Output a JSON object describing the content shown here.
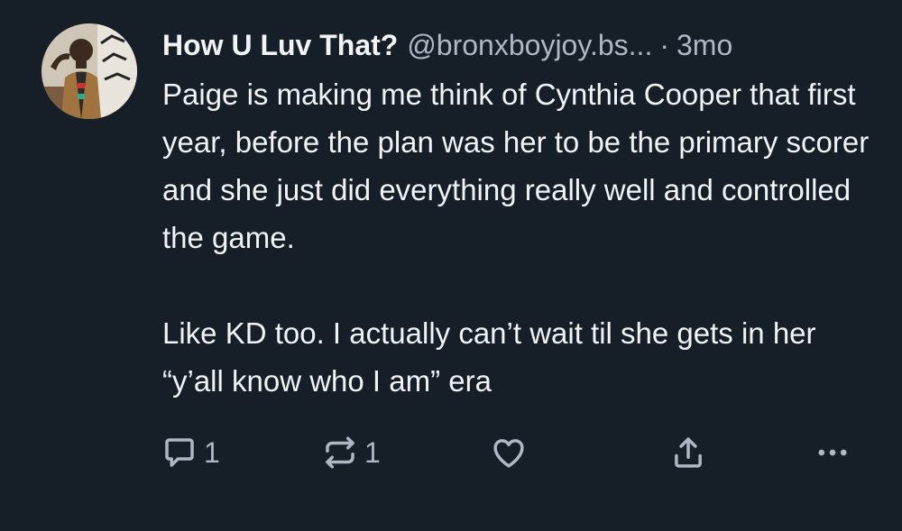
{
  "post": {
    "author": {
      "display_name": "How U Luv That?",
      "handle": "@bronxboyjoy.bs...",
      "avatar_icon": "user-avatar"
    },
    "separator": "·",
    "time": "3mo",
    "paragraphs": [
      "Paige is making me think of Cynthia Cooper that first year, before the plan was her to be the primary scorer and she just did everything really well and controlled the game.",
      "Like KD too. I actually can’t wait til she gets in her “y’all know who I am” era"
    ],
    "actions": {
      "reply_count": "1",
      "repost_count": "1",
      "icons": [
        "reply-icon",
        "repost-icon",
        "like-icon",
        "share-icon",
        "more-icon"
      ]
    }
  },
  "colors": {
    "background": "#161e27",
    "text": "#f1f3f5",
    "muted": "#aeb8c4"
  }
}
